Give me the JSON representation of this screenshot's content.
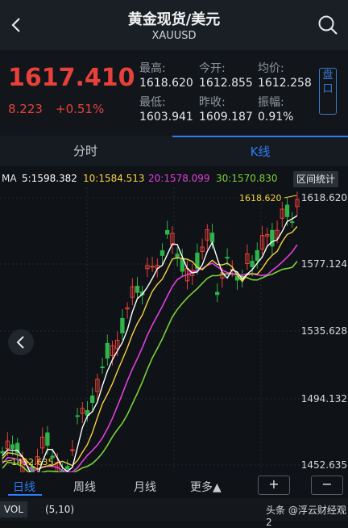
{
  "header": {
    "title": "黄金现货/美元",
    "subtitle": "XAUUSD"
  },
  "quote": {
    "price": "1617.410",
    "change": "8.223",
    "change_pct": "+0.51%",
    "stats": [
      {
        "label": "最高:",
        "value": "1618.620"
      },
      {
        "label": "今开:",
        "value": "1612.855"
      },
      {
        "label": "均价:",
        "value": "1612.258"
      },
      {
        "label": "最低:",
        "value": "1603.941"
      },
      {
        "label": "昨收:",
        "value": "1609.187"
      },
      {
        "label": "振幅:",
        "value": "0.91%"
      }
    ],
    "pan_label": "盘口"
  },
  "tabs": {
    "minute": "分时",
    "kline": "K线"
  },
  "ma": {
    "label": "MA",
    "ma5": "5:1598.382",
    "ma10": "10:1584.513",
    "ma20": "20:1578.099",
    "ma30": "30:1570.830",
    "stats_button": "区间统计"
  },
  "colors": {
    "up": "#e8403a",
    "down": "#2fb34a",
    "ma5": "#ffffff",
    "ma10": "#f5d442",
    "ma20": "#e040e0",
    "ma30": "#7bd23a",
    "accent": "#2e7cf6"
  },
  "chart": {
    "axis_labels": [
      "1618.620",
      "1577.124",
      "1535.628",
      "1494.132",
      "1452.635"
    ],
    "high_label": "1618.620",
    "low_label": "1452.635"
  },
  "periods": {
    "day": "日线",
    "week": "周线",
    "month": "月线",
    "more": "更多▲",
    "zoom_in": "+",
    "zoom_out": "−"
  },
  "bottom": {
    "vol": "VOL",
    "params": "(5,10)",
    "watermark": "头条 @浮云财经观 2"
  }
}
